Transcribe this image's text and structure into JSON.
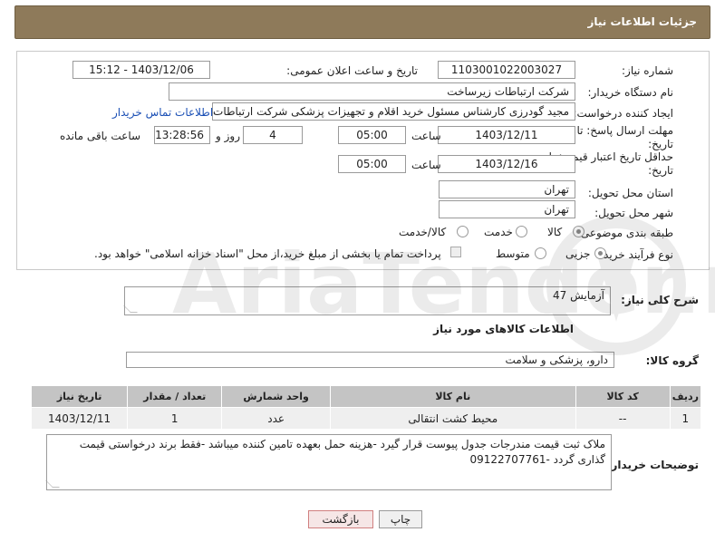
{
  "header": {
    "title": "جزئیات اطلاعات نیاز"
  },
  "form": {
    "need_number": {
      "label": "شماره نیاز:",
      "value": "1103001022003027"
    },
    "announce": {
      "label": "تاریخ و ساعت اعلان عمومی:",
      "value": "1403/12/06 - 15:12"
    },
    "buyer_org": {
      "label": "نام دستگاه خریدار:",
      "value": "شرکت ارتباطات زیرساخت"
    },
    "creator": {
      "label": "ایجاد کننده درخواست:",
      "value": "مجید گودرزی کارشناس مسئول خرید اقلام و تجهیزات پزشکی شرکت ارتباطات ز",
      "contact_link": "اطلاعات تماس خریدار"
    },
    "reply_deadline": {
      "label_line1": "مهلت ارسال پاسخ: تا",
      "label_line2": "تاریخ:",
      "date": "1403/12/11",
      "time_label": "ساعت",
      "time": "05:00",
      "days": "4",
      "days_label": "روز و",
      "remaining": "13:28:56",
      "remaining_label": "ساعت باقی مانده"
    },
    "price_validity": {
      "label_line1": "حداقل تاریخ اعتبار قیمت: تا",
      "label_line2": "تاریخ:",
      "date": "1403/12/16",
      "time_label": "ساعت",
      "time": "05:00"
    },
    "province": {
      "label": "استان محل تحویل:",
      "value": "تهران"
    },
    "city": {
      "label": "شهر محل تحویل:",
      "value": "تهران"
    },
    "category": {
      "label": "طبقه بندی موضوعی:",
      "options": [
        "کالا",
        "خدمت",
        "کالا/خدمت"
      ],
      "selected": "کالا"
    },
    "process": {
      "label": "نوع فرآیند خرید :",
      "options": [
        "جزیی",
        "متوسط"
      ],
      "selected": "جزیی",
      "payment_note": "پرداخت تمام یا بخشی از مبلغ خرید،از محل \"اسناد خزانه اسلامی\" خواهد بود."
    }
  },
  "summary": {
    "label": "شرح کلی نیاز:",
    "value": "آزمایش 47"
  },
  "goods_info": {
    "title": "اطلاعات کالاهای مورد نیاز"
  },
  "goods_group": {
    "label": "گروه کالا:",
    "value": "دارو، پزشکی و سلامت"
  },
  "table": {
    "headers": [
      "ردیف",
      "کد کالا",
      "نام کالا",
      "واحد شمارش",
      "تعداد / مقدار",
      "تاریخ نیاز"
    ],
    "rows": [
      [
        "1",
        "--",
        "محیط کشت انتقالی",
        "عدد",
        "1",
        "1403/12/11"
      ]
    ]
  },
  "buyer_notes": {
    "label": "توضیحات خریدار:",
    "value": "ملاک ثبت قیمت مندرجات جدول پیوست قرار گیرد -هزینه حمل بعهده تامین کننده میباشد -فقط برند درخواستی قیمت گذاری گردد -09122707761"
  },
  "buttons": {
    "print": "چاپ",
    "back": "بازگشت"
  },
  "colors": {
    "header_bg": "#8e7a5a",
    "link": "#1a4fb5",
    "table_header": "#c4c4c4"
  },
  "watermark": {
    "text": "AriaTender.net"
  }
}
